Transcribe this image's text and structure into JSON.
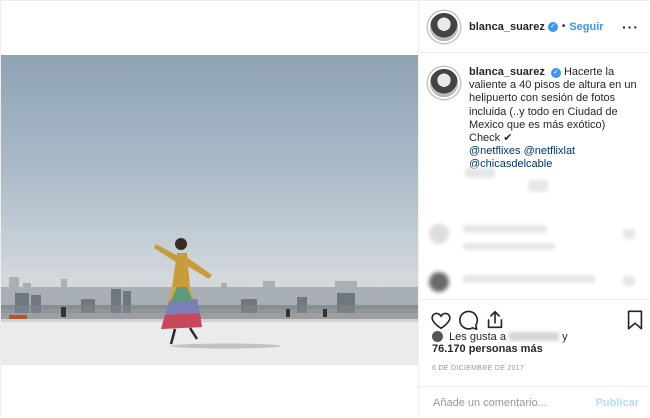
{
  "post": {
    "username": "blanca_suarez",
    "dot": "•",
    "follow_label": "Seguir",
    "more_label": "···",
    "caption": {
      "username": "blanca_suarez",
      "text": "Hacerte la valiente a 40 pisos de altura en un helipuerto con sesión de fotos incluida (..y todo en Ciudad de Mexico que es más exótico) Check ✔",
      "mentions": [
        "@netflixes",
        "@netflixlat",
        "@chicasdelcable"
      ]
    },
    "likes": {
      "prefix": "Les gusta a",
      "suffix": "y",
      "count_line": "76.170 personas más"
    },
    "date": "6 DE DICIEMBRE DE 2017",
    "comment_placeholder": "Añade un comentario...",
    "publish_label": "Publicar"
  },
  "icons": [
    "verified-badge-icon",
    "more-options-icon",
    "heart-icon",
    "comment-icon",
    "share-icon",
    "bookmark-icon"
  ],
  "colors": {
    "accent": "#3897f0",
    "text": "#262626",
    "muted": "#999999",
    "mention": "#003569",
    "publish_disabled": "#b2dffc"
  }
}
